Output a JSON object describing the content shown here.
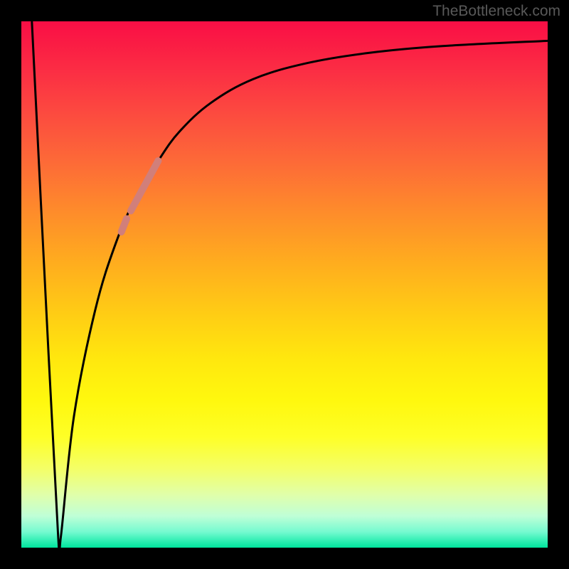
{
  "attribution": "TheBottleneck.com",
  "chart_data": {
    "type": "line",
    "title": "",
    "xlabel": "",
    "ylabel": "",
    "xlim": [
      0,
      100
    ],
    "ylim": [
      0,
      100
    ],
    "grid": false,
    "legend": false,
    "background_gradient": {
      "direction": "vertical",
      "stops": [
        {
          "pos": 0.0,
          "color": "#fa0e45"
        },
        {
          "pos": 0.5,
          "color": "#ffc016"
        },
        {
          "pos": 0.75,
          "color": "#fffb10"
        },
        {
          "pos": 0.95,
          "color": "#9bffcc"
        },
        {
          "pos": 1.0,
          "color": "#00e49c"
        }
      ]
    },
    "series": [
      {
        "name": "bottleneck-curve",
        "color": "#000000",
        "points": [
          {
            "x": 2.0,
            "y": 100.0
          },
          {
            "x": 4.5,
            "y": 50.0
          },
          {
            "x": 7.0,
            "y": 2.0
          },
          {
            "x": 7.5,
            "y": 2.0
          },
          {
            "x": 10.0,
            "y": 25.0
          },
          {
            "x": 14.0,
            "y": 45.0
          },
          {
            "x": 18.0,
            "y": 58.0
          },
          {
            "x": 22.0,
            "y": 67.0
          },
          {
            "x": 26.0,
            "y": 73.5
          },
          {
            "x": 30.0,
            "y": 79.0
          },
          {
            "x": 36.0,
            "y": 84.5
          },
          {
            "x": 44.0,
            "y": 89.0
          },
          {
            "x": 54.0,
            "y": 92.0
          },
          {
            "x": 66.0,
            "y": 94.0
          },
          {
            "x": 80.0,
            "y": 95.3
          },
          {
            "x": 100.0,
            "y": 96.3
          }
        ]
      },
      {
        "name": "highlight-segment",
        "color": "#d17f7a",
        "stroke_width_px": 10,
        "points": [
          {
            "x": 20.8,
            "y": 64.0
          },
          {
            "x": 26.0,
            "y": 73.5
          }
        ]
      },
      {
        "name": "highlight-dot",
        "color": "#d17f7a",
        "stroke_width_px": 10,
        "points": [
          {
            "x": 19.0,
            "y": 60.0
          },
          {
            "x": 20.0,
            "y": 62.5
          }
        ]
      }
    ]
  }
}
